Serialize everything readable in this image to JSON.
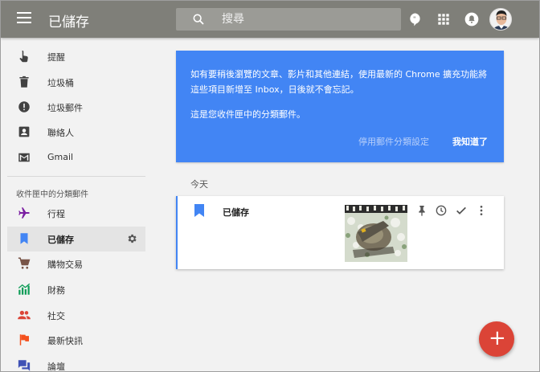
{
  "app": {
    "title": "已儲存"
  },
  "search": {
    "placeholder": "搜尋",
    "value": ""
  },
  "sidebar": {
    "items": [
      {
        "label": "提醒",
        "icon": "reminder-hand-icon"
      },
      {
        "label": "垃圾桶",
        "icon": "trash-icon"
      },
      {
        "label": "垃圾郵件",
        "icon": "spam-icon"
      },
      {
        "label": "聯絡人",
        "icon": "contacts-icon"
      },
      {
        "label": "Gmail",
        "icon": "gmail-icon"
      }
    ],
    "section_title": "收件匣中的分類郵件",
    "bundles": [
      {
        "label": "行程",
        "icon": "airplane-icon",
        "color": "#7b1fa2"
      },
      {
        "label": "已儲存",
        "icon": "bookmark-icon",
        "color": "#4285f4",
        "active": true
      },
      {
        "label": "購物交易",
        "icon": "cart-icon",
        "color": "#795548"
      },
      {
        "label": "財務",
        "icon": "chart-icon",
        "color": "#0f9d58"
      },
      {
        "label": "社交",
        "icon": "people-icon",
        "color": "#db4437"
      },
      {
        "label": "最新快訊",
        "icon": "flag-icon",
        "color": "#f4511e"
      },
      {
        "label": "論壇",
        "icon": "forum-icon",
        "color": "#3f51b5"
      }
    ]
  },
  "banner": {
    "text1": "如有要稍後瀏覽的文章、影片和其他連結，使用最新的 Chrome 擴充功能將這些項目新增至 Inbox，日後就不會忘記。",
    "text2": "這是您收件匣中的分類郵件。",
    "disable_label": "停用郵件分類設定",
    "ok_label": "我知道了"
  },
  "list": {
    "day_label": "今天",
    "items": [
      {
        "title": "已儲存"
      }
    ]
  },
  "colors": {
    "topbar": "#7f7f79",
    "banner": "#4285f4",
    "fab": "#db4437"
  },
  "fab": {
    "label": "+"
  }
}
